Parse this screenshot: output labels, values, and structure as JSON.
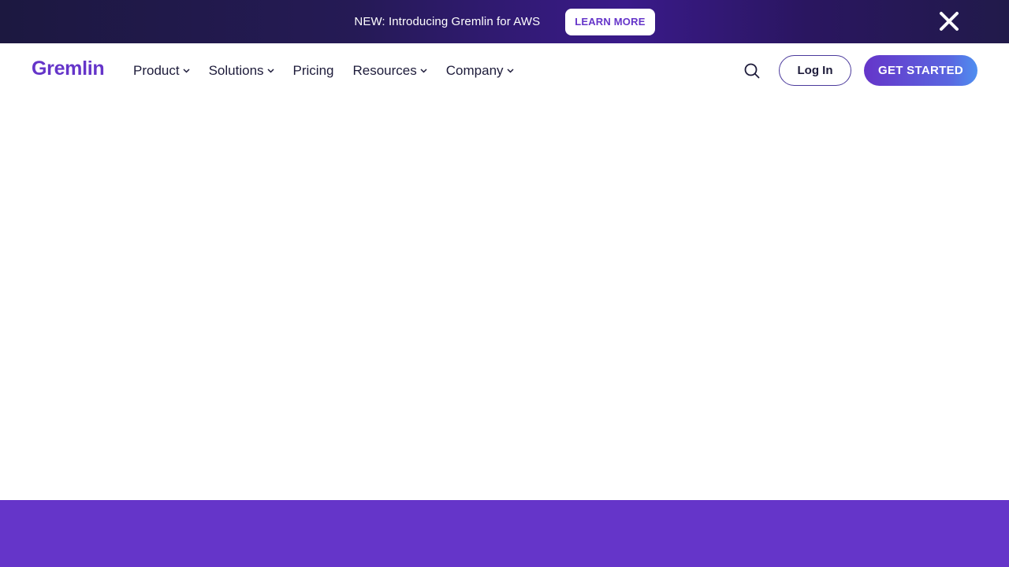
{
  "announcement": {
    "text": "NEW: Introducing Gremlin for AWS",
    "cta_label": "LEARN MORE",
    "close_icon": "close-icon"
  },
  "nav": {
    "logo": "Gremlin",
    "items": [
      {
        "label": "Product",
        "has_dropdown": true
      },
      {
        "label": "Solutions",
        "has_dropdown": true
      },
      {
        "label": "Pricing",
        "has_dropdown": false
      },
      {
        "label": "Resources",
        "has_dropdown": true
      },
      {
        "label": "Company",
        "has_dropdown": true
      }
    ],
    "search_icon": "search-icon",
    "login_label": "Log In",
    "cta_label": "GET STARTED"
  },
  "colors": {
    "brand": "#6535c9",
    "announcement_bg": "#221a4c",
    "text_dark": "#1d1b3a",
    "footer_band": "#6535c9"
  }
}
